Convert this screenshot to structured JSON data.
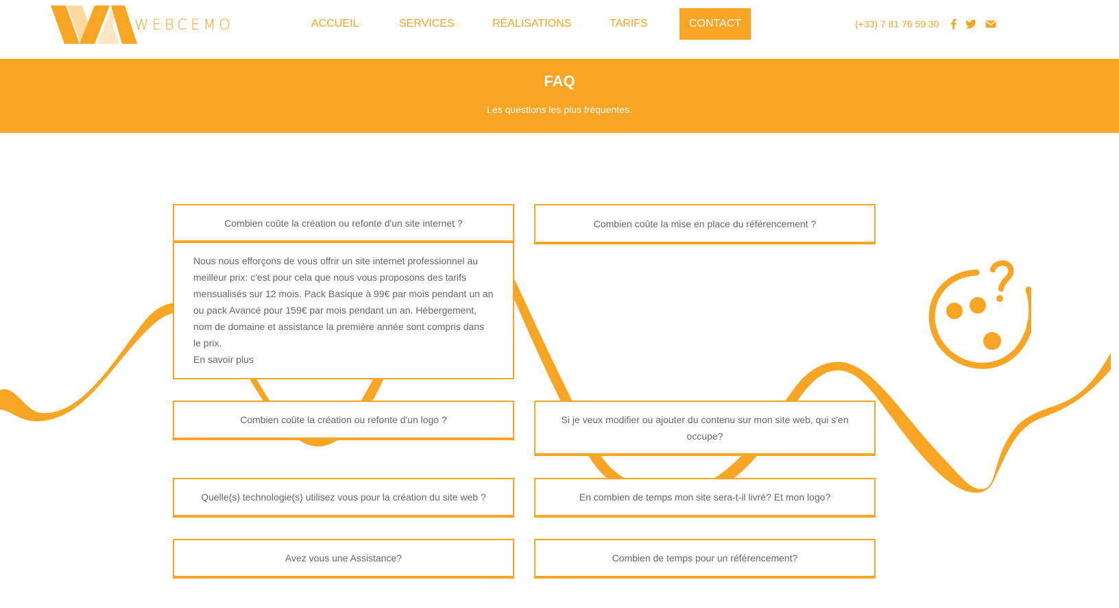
{
  "brand": {
    "name": "WEBCEMO",
    "accent_color": "#f9a524",
    "light_color": "#fde0b0"
  },
  "nav": {
    "items": [
      {
        "label": "ACCUEIL"
      },
      {
        "label": "SERVICES"
      },
      {
        "label": "RÉALISATIONS"
      },
      {
        "label": "TARIFS"
      },
      {
        "label": "CONTACT",
        "active": true
      }
    ]
  },
  "contact": {
    "phone": "(+33) 7 81 76 59 30",
    "icons": [
      "facebook-icon",
      "twitter-icon",
      "envelope-icon"
    ]
  },
  "banner": {
    "title": "FAQ",
    "subtitle": "Les questions les plus fréquentes."
  },
  "faq": {
    "left": [
      {
        "question": "Combien coûte la création ou refonte d'un site internet ?",
        "expanded": true
      },
      {
        "question": "Combien coûte la création ou refonte d'un logo ?"
      },
      {
        "question": "Quelle(s) technologie(s) utilisez vous pour la création du site web ?"
      },
      {
        "question": "Avez vous une Assistance?"
      }
    ],
    "right": [
      {
        "question": "Combien coûte la mise en place du référencement ?"
      },
      {
        "question": "Si je veux modifier ou ajouter du contenu sur mon site web, qui s'en occupe?"
      },
      {
        "question": "En combien de temps mon site sera-t-il livré? Et mon logo?"
      },
      {
        "question": "Combien de temps pour un référencement?"
      }
    ],
    "answer": {
      "text": "Nous nous efforçons de vous offrir un site internet professionnel au meilleur prix: c'est pour cela que nous vous proposons des tarifs mensualisés sur 12 mois. Pack Basique à 99€ par mois pendant un an ou pack Avancé pour 159€ par mois pendant un an. Hébergement, nom de domaine et assistance la première année sont compris dans le prix.",
      "link": "En savoir plus"
    }
  },
  "decor": {
    "icon": "question-face-icon"
  }
}
